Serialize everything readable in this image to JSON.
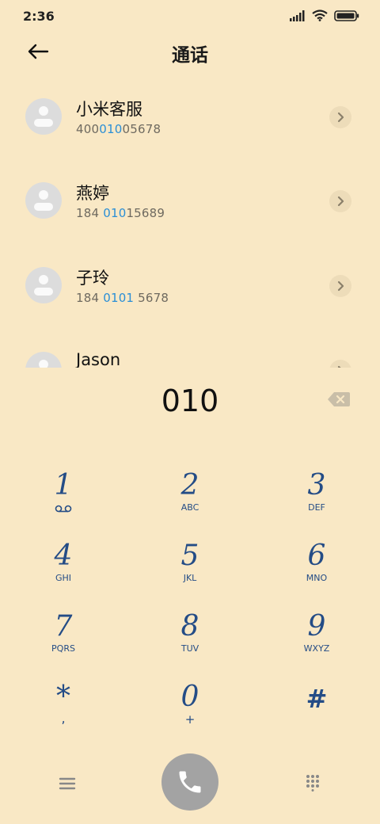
{
  "status": {
    "time": "2:36"
  },
  "header": {
    "title": "通话"
  },
  "contacts": [
    {
      "name": "小米客服",
      "number_parts": [
        "400",
        "010",
        "05678"
      ]
    },
    {
      "name": "燕婷",
      "number_parts": [
        "184 ",
        "010",
        "15689"
      ]
    },
    {
      "name": "子玲",
      "number_parts": [
        "184 ",
        "0101",
        " 5678"
      ]
    },
    {
      "name": "Jason",
      "number_parts": [
        "",
        "",
        ""
      ]
    }
  ],
  "dialer": {
    "number": "010"
  },
  "keypad": [
    {
      "digit": "1",
      "letters": ""
    },
    {
      "digit": "2",
      "letters": "ABC"
    },
    {
      "digit": "3",
      "letters": "DEF"
    },
    {
      "digit": "4",
      "letters": "GHI"
    },
    {
      "digit": "5",
      "letters": "JKL"
    },
    {
      "digit": "6",
      "letters": "MNO"
    },
    {
      "digit": "7",
      "letters": "PQRS"
    },
    {
      "digit": "8",
      "letters": "TUV"
    },
    {
      "digit": "9",
      "letters": "WXYZ"
    },
    {
      "digit": "*",
      "letters": ","
    },
    {
      "digit": "0",
      "letters": "+"
    },
    {
      "digit": "#",
      "letters": ""
    }
  ],
  "icons": {
    "back": "back-arrow-icon",
    "voicemail": "voicemail-icon",
    "backspace": "backspace-icon",
    "menu": "menu-icon",
    "call": "phone-icon",
    "dialpad": "dialpad-icon"
  },
  "colors": {
    "background": "#f9e8c5",
    "highlight": "#2b8fd6",
    "keypad": "#244c86",
    "call_button": "#a3a3a3"
  }
}
